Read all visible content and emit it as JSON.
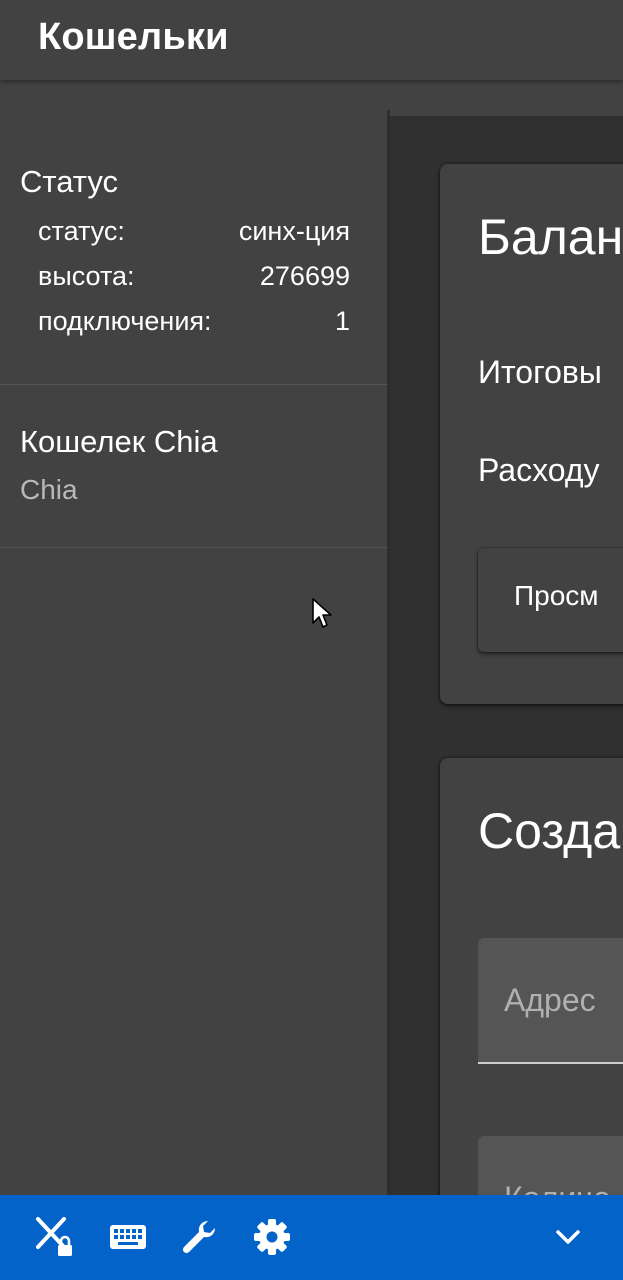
{
  "app": {
    "title": "Кошельки"
  },
  "sidebar": {
    "status": {
      "heading": "Статус",
      "rows": [
        {
          "label": "статус:",
          "value": "синх-ция"
        },
        {
          "label": "высота:",
          "value": "276699"
        },
        {
          "label": "подключения:",
          "value": "1"
        }
      ]
    },
    "wallets": [
      {
        "name": "Кошелек Chia",
        "type": "Chia"
      }
    ]
  },
  "main": {
    "balance_card": {
      "title": "Балан",
      "lines": [
        "Итоговы",
        "Расходу"
      ],
      "view_panel_label": "Просм"
    },
    "create_card": {
      "title": "Созда",
      "address_placeholder": "Адрес",
      "amount_placeholder": "Количе"
    }
  },
  "taskbar": {
    "icons": [
      "close-lock-icon",
      "keyboard-icon",
      "wrench-icon",
      "gear-icon",
      "chevron-down-icon"
    ]
  },
  "colors": {
    "background": "#424242",
    "content_background": "#303030",
    "taskbar": "#0463c9",
    "secondary_text": "#b8b8b8"
  }
}
